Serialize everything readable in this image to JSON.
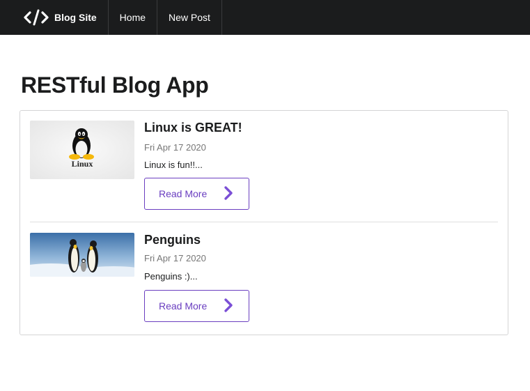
{
  "navbar": {
    "brand_label": "Blog Site",
    "brand_icon": "code-icon",
    "items": [
      {
        "label": "Home"
      },
      {
        "label": "New Post"
      }
    ]
  },
  "page": {
    "title": "RESTful Blog App"
  },
  "posts": [
    {
      "title": "Linux is GREAT!",
      "date": "Fri Apr 17 2020",
      "excerpt": "Linux is fun!!...",
      "image_label": "Linux",
      "read_more_label": "Read More"
    },
    {
      "title": "Penguins",
      "date": "Fri Apr 17 2020",
      "excerpt": "Penguins :)...",
      "read_more_label": "Read More"
    }
  ],
  "colors": {
    "navbar_bg": "#1b1c1d",
    "accent": "#6a3ec0",
    "border": "#d4d4d5",
    "muted_text": "#767676"
  }
}
